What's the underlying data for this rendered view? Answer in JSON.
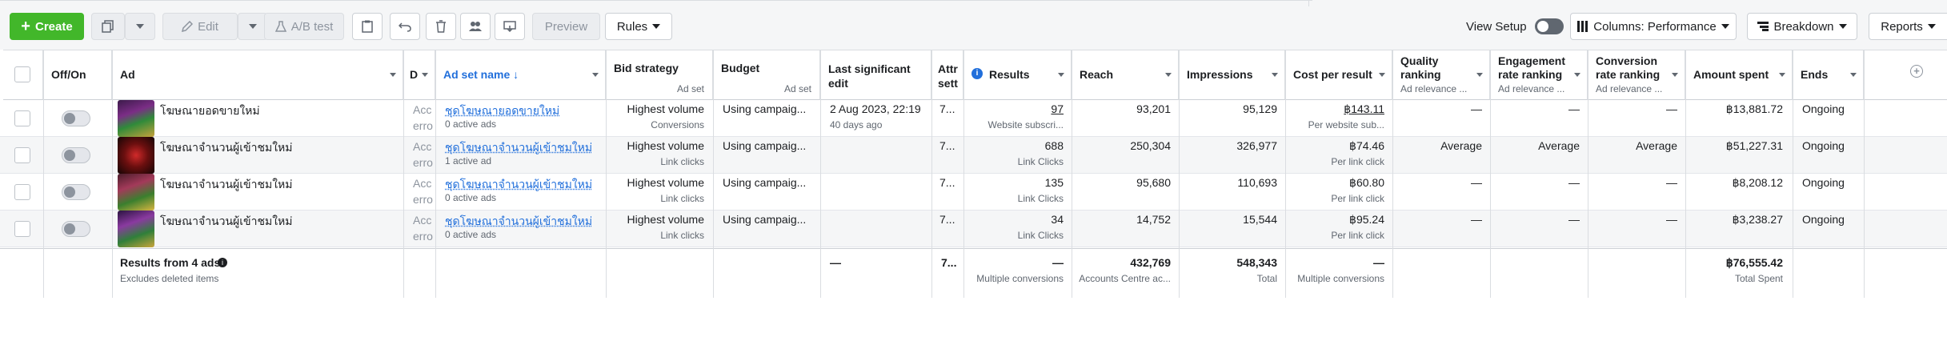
{
  "toolbar": {
    "create_label": "Create",
    "edit_label": "Edit",
    "ab_test_label": "A/B test",
    "preview_label": "Preview",
    "rules_label": "Rules",
    "view_setup_label": "View Setup",
    "columns_label": "Columns: Performance",
    "breakdown_label": "Breakdown",
    "reports_label": "Reports"
  },
  "columns": [
    {
      "key": "offon",
      "label": "Off/On"
    },
    {
      "key": "ad",
      "label": "Ad"
    },
    {
      "key": "delivery",
      "label": "D"
    },
    {
      "key": "adset",
      "label": "Ad set name"
    },
    {
      "key": "bid",
      "label": "Bid strategy",
      "sub": "Ad set"
    },
    {
      "key": "budget",
      "label": "Budget",
      "sub": "Ad set"
    },
    {
      "key": "last_edit",
      "label": "Last significant edit"
    },
    {
      "key": "attr",
      "label": "Attr sett"
    },
    {
      "key": "results",
      "label": "Results"
    },
    {
      "key": "reach",
      "label": "Reach"
    },
    {
      "key": "impressions",
      "label": "Impressions"
    },
    {
      "key": "cpr",
      "label": "Cost per result"
    },
    {
      "key": "quality",
      "label": "Quality ranking",
      "sub": "Ad relevance ..."
    },
    {
      "key": "engagement",
      "label": "Engagement rate ranking",
      "sub": "Ad relevance ..."
    },
    {
      "key": "conversion",
      "label": "Conversion rate ranking",
      "sub": "Ad relevance ..."
    },
    {
      "key": "amount",
      "label": "Amount spent"
    },
    {
      "key": "ends",
      "label": "Ends"
    }
  ],
  "rows": [
    {
      "ad_name": "โฆษณายอดขายใหม่",
      "delivery": "Acc",
      "delivery_sub": "erro",
      "adset_name": "ชุดโฆษณายอดขายใหม่",
      "adset_sub": "0 active ads",
      "bid": "Highest volume",
      "bid_sub": "Conversions",
      "budget": "Using campaig...",
      "last_edit": "2 Aug 2023, 22:19",
      "last_edit_sub": "40 days ago",
      "attr": "7...",
      "results": "97",
      "results_sub": "Website subscri...",
      "reach": "93,201",
      "impressions": "95,129",
      "cpr": "฿143.11",
      "cpr_sub": "Per website sub...",
      "quality": "—",
      "engagement": "—",
      "conversion": "—",
      "amount": "฿13,881.72",
      "ends": "Ongoing"
    },
    {
      "ad_name": "โฆษณาจำนวนผู้เข้าชมใหม่",
      "delivery": "Acc",
      "delivery_sub": "erro",
      "adset_name": "ชุดโฆษณาจำนวนผู้เข้าชมใหม่",
      "adset_sub": "1 active ad",
      "bid": "Highest volume",
      "bid_sub": "Link clicks",
      "budget": "Using campaig...",
      "last_edit": "",
      "last_edit_sub": "",
      "attr": "7...",
      "results": "688",
      "results_sub": "Link Clicks",
      "reach": "250,304",
      "impressions": "326,977",
      "cpr": "฿74.46",
      "cpr_sub": "Per link click",
      "quality": "Average",
      "engagement": "Average",
      "conversion": "Average",
      "amount": "฿51,227.31",
      "ends": "Ongoing"
    },
    {
      "ad_name": "โฆษณาจำนวนผู้เข้าชมใหม่",
      "delivery": "Acc",
      "delivery_sub": "erro",
      "adset_name": "ชุดโฆษณาจำนวนผู้เข้าชมใหม่",
      "adset_sub": "0 active ads",
      "bid": "Highest volume",
      "bid_sub": "Link clicks",
      "budget": "Using campaig...",
      "last_edit": "",
      "last_edit_sub": "",
      "attr": "7...",
      "results": "135",
      "results_sub": "Link Clicks",
      "reach": "95,680",
      "impressions": "110,693",
      "cpr": "฿60.80",
      "cpr_sub": "Per link click",
      "quality": "—",
      "engagement": "—",
      "conversion": "—",
      "amount": "฿8,208.12",
      "ends": "Ongoing"
    },
    {
      "ad_name": "โฆษณาจำนวนผู้เข้าชมใหม่",
      "delivery": "Acc",
      "delivery_sub": "erro",
      "adset_name": "ชุดโฆษณาจำนวนผู้เข้าชมใหม่",
      "adset_sub": "0 active ads",
      "bid": "Highest volume",
      "bid_sub": "Link clicks",
      "budget": "Using campaig...",
      "last_edit": "",
      "last_edit_sub": "",
      "attr": "7...",
      "results": "34",
      "results_sub": "Link Clicks",
      "reach": "14,752",
      "impressions": "15,544",
      "cpr": "฿95.24",
      "cpr_sub": "Per link click",
      "quality": "—",
      "engagement": "—",
      "conversion": "—",
      "amount": "฿3,238.27",
      "ends": "Ongoing"
    }
  ],
  "totals": {
    "label": "Results from 4 ads",
    "sub": "Excludes deleted items",
    "last_edit": "—",
    "attr": "7...",
    "results": "—",
    "results_sub": "Multiple conversions",
    "reach": "432,769",
    "reach_sub": "Accounts Centre ac...",
    "impressions": "548,343",
    "impressions_sub": "Total",
    "cpr": "—",
    "cpr_sub": "Multiple conversions",
    "amount": "฿76,555.42",
    "amount_sub": "Total Spent"
  },
  "colors": {
    "accent": "#42b72a",
    "link": "#216fdb",
    "border": "#dadde1"
  }
}
